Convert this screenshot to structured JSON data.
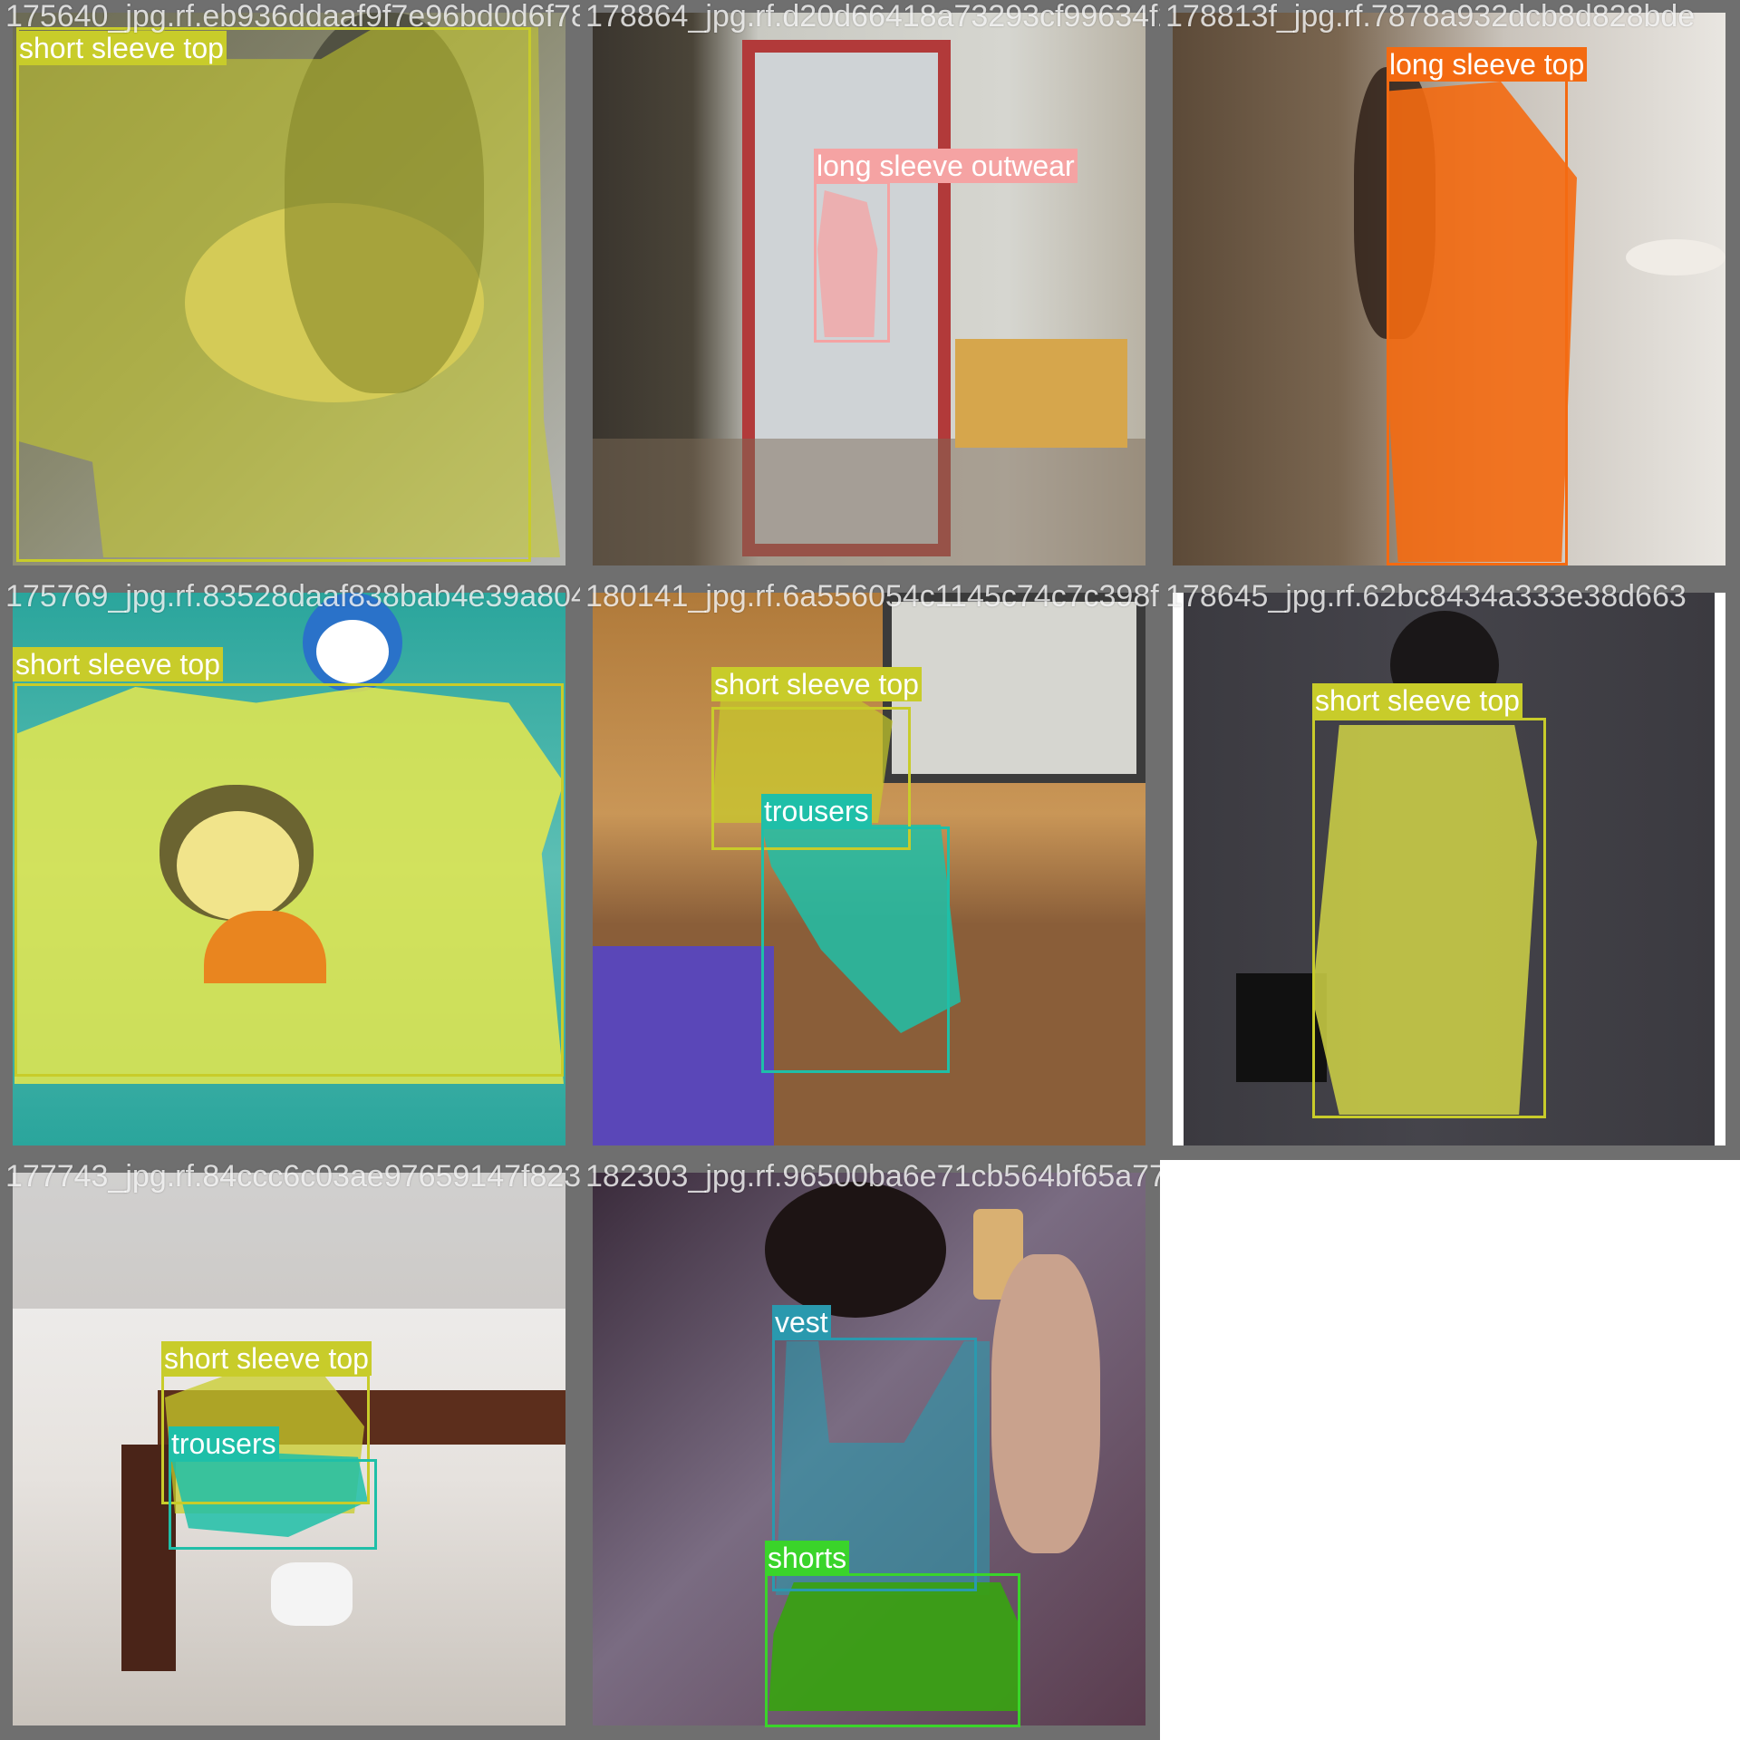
{
  "colors": {
    "short_sleeve_top": "#c8cc2a",
    "long_sleeve_outwear": "#f5a3a3",
    "long_sleeve_top": "#f46a11",
    "trousers": "#1fbfa8",
    "vest": "#2a99ae",
    "shorts": "#3ad42a"
  },
  "tiles": [
    {
      "filename": "175640_jpg.rf.eb936ddaaf9f7e96bd0d6f78866",
      "detections": [
        {
          "label": "short sleeve top",
          "class": "short_sleeve_top"
        }
      ]
    },
    {
      "filename": "178864_jpg.rf.d20d66418a73293cf99634f2f3",
      "detections": [
        {
          "label": "long sleeve outwear",
          "class": "long_sleeve_outwear"
        }
      ]
    },
    {
      "filename": "178813f_jpg.rf.7878a932dcb8d828bde",
      "detections": [
        {
          "label": "long sleeve top",
          "class": "long_sleeve_top"
        }
      ]
    },
    {
      "filename": "175769_jpg.rf.83528daaf838bab4e39a804f43",
      "detections": [
        {
          "label": "short sleeve top",
          "class": "short_sleeve_top"
        }
      ]
    },
    {
      "filename": "180141_jpg.rf.6a556054c1145c74c7c398f6445",
      "detections": [
        {
          "label": "short sleeve top",
          "class": "short_sleeve_top"
        },
        {
          "label": "trousers",
          "class": "trousers"
        }
      ]
    },
    {
      "filename": "178645_jpg.rf.62bc8434a333e38d663",
      "detections": [
        {
          "label": "short sleeve top",
          "class": "short_sleeve_top"
        }
      ]
    },
    {
      "filename": "177743_jpg.rf.84ccc6c03ae97659147f82303",
      "detections": [
        {
          "label": "short sleeve top",
          "class": "short_sleeve_top"
        },
        {
          "label": "trousers",
          "class": "trousers"
        }
      ]
    },
    {
      "filename": "182303_jpg.rf.96500ba6e71cb564bf65a7722f",
      "detections": [
        {
          "label": "vest",
          "class": "vest"
        },
        {
          "label": "shorts",
          "class": "shorts"
        }
      ]
    }
  ]
}
